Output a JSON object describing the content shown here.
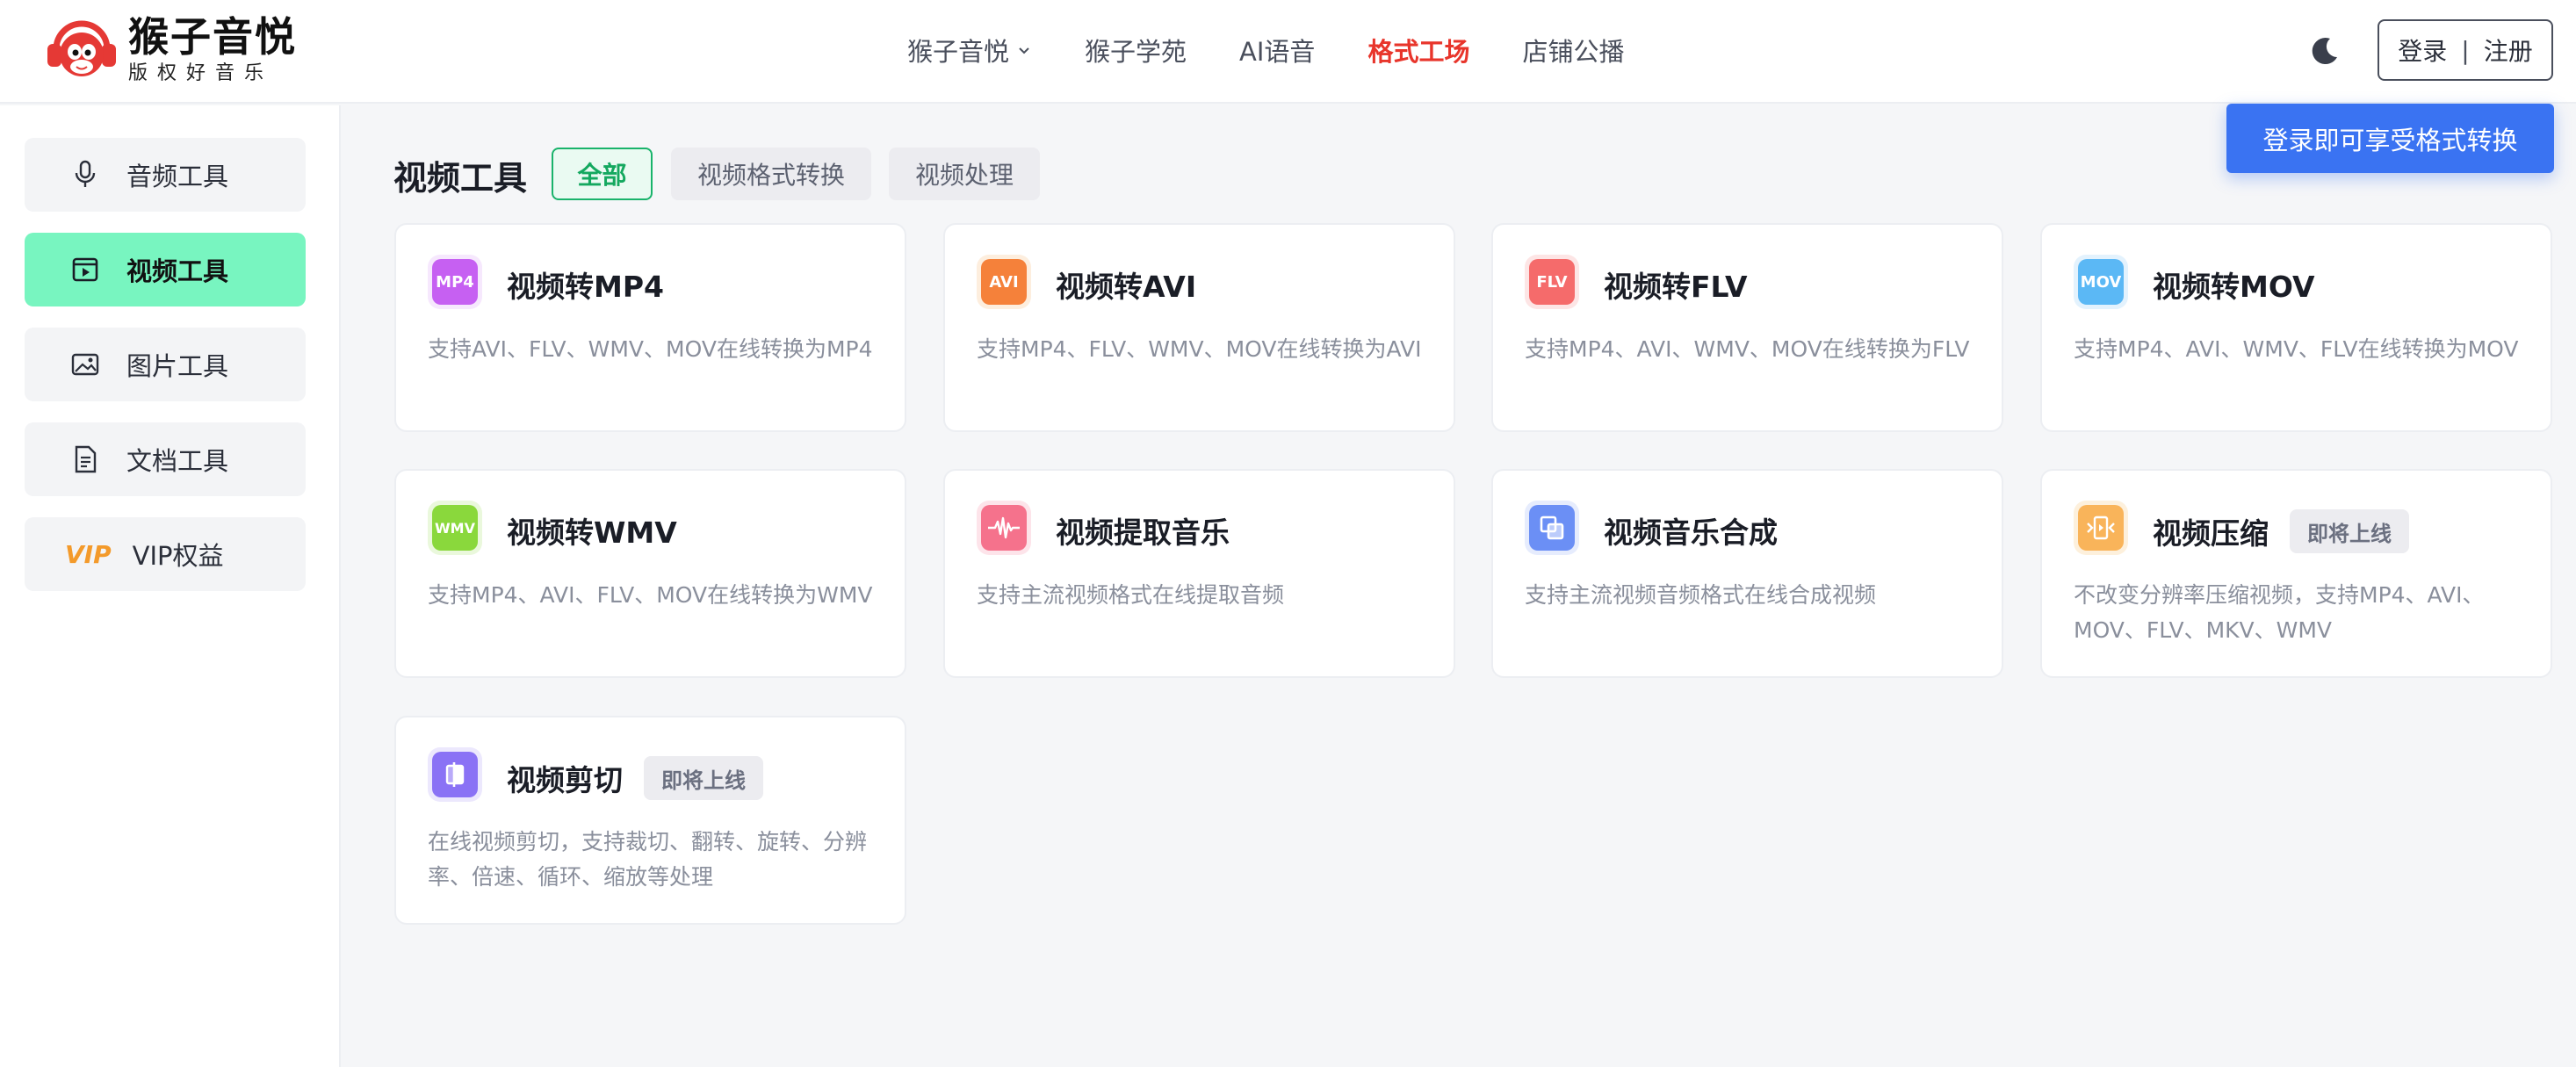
{
  "brand": {
    "title": "猴子音悦",
    "subtitle": "版权好音乐"
  },
  "nav": {
    "items": [
      {
        "label": "猴子音悦",
        "has_dropdown": true
      },
      {
        "label": "猴子学苑"
      },
      {
        "label": "AI语音"
      },
      {
        "label": "格式工场",
        "active": true
      },
      {
        "label": "店铺公播"
      }
    ]
  },
  "header": {
    "login": "登录",
    "register": "注册",
    "tooltip": "登录即可享受格式转换"
  },
  "sidebar": {
    "items": [
      {
        "label": "音频工具",
        "icon": "microphone-icon"
      },
      {
        "label": "视频工具",
        "icon": "video-icon",
        "active": true
      },
      {
        "label": "图片工具",
        "icon": "image-icon"
      },
      {
        "label": "文档工具",
        "icon": "document-icon"
      },
      {
        "label": "VIP权益",
        "icon": "vip-icon",
        "icon_text": "VIP"
      }
    ]
  },
  "main": {
    "title": "视频工具",
    "filters": [
      {
        "label": "全部",
        "active": true
      },
      {
        "label": "视频格式转换"
      },
      {
        "label": "视频处理"
      }
    ],
    "cards": [
      {
        "title": "视频转MP4",
        "desc": "支持AVI、FLV、WMV、MOV在线转换为MP4",
        "icon_text": "MP4",
        "color": "#c660f2",
        "bg": "#f6e8fd"
      },
      {
        "title": "视频转AVI",
        "desc": "支持MP4、FLV、WMV、MOV在线转换为AVI",
        "icon_text": "AVI",
        "color": "#f5813a",
        "bg": "#fdeede"
      },
      {
        "title": "视频转FLV",
        "desc": "支持MP4、AVI、WMV、MOV在线转换为FLV",
        "icon_text": "FLV",
        "color": "#f56b6b",
        "bg": "#fde5e5"
      },
      {
        "title": "视频转MOV",
        "desc": "支持MP4、AVI、WMV、FLV在线转换为MOV",
        "icon_text": "MOV",
        "color": "#5bb8f5",
        "bg": "#e3f2fd"
      },
      {
        "title": "视频转WMV",
        "desc": "支持MP4、AVI、FLV、MOV在线转换为WMV",
        "icon_text": "WMV",
        "color": "#8ad83c",
        "bg": "#eaf8dc"
      },
      {
        "title": "视频提取音乐",
        "desc": "支持主流视频格式在线提取音频",
        "icon_text": "",
        "color": "#f5728c",
        "bg": "#fde4ea"
      },
      {
        "title": "视频音乐合成",
        "desc": "支持主流视频音频格式在线合成视频",
        "icon_text": "",
        "color": "#6b8ff5",
        "bg": "#e6ecfd"
      },
      {
        "title": "视频压缩",
        "desc": "不改变分辨率压缩视频，支持MP4、AVI、MOV、FLV、MKV、WMV",
        "icon_text": "",
        "color": "#f9b45a",
        "bg": "#fdf0dc",
        "badge": "即将上线"
      },
      {
        "title": "视频剪切",
        "desc": "在线视频剪切，支持裁切、翻转、旋转、分辨率、倍速、循环、缩放等处理",
        "icon_text": "",
        "color": "#8a72f5",
        "bg": "#ece8fd",
        "badge": "即将上线"
      }
    ]
  },
  "colors": {
    "accent_green": "#78f5c0",
    "active_nav": "#e8352b",
    "tooltip_blue": "#3a73f2"
  }
}
